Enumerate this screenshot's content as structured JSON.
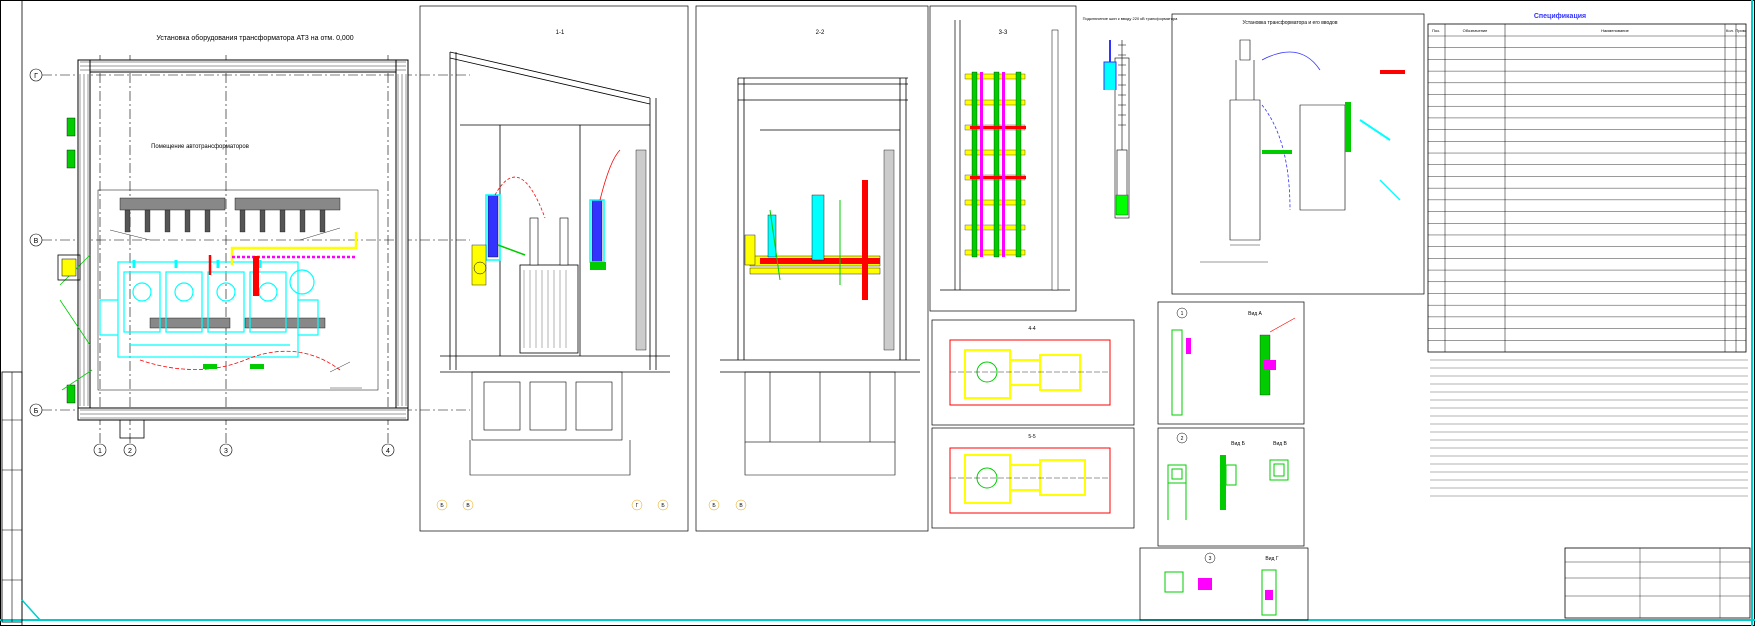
{
  "sheet": {
    "plan_title": "Установка оборудования трансформатора АТ3 на отм. 0,000",
    "plan_room_label": "Помещение автотрансформаторов",
    "section_labels": [
      "1-1",
      "2-2",
      "3-3",
      "4-4",
      "5-5"
    ],
    "grid_rows": [
      "Г",
      "В",
      "Б"
    ],
    "grid_cols": [
      "1",
      "2",
      "3",
      "4"
    ],
    "axis_letters_bottom": [
      "Б",
      "В",
      "Г",
      "Б"
    ],
    "terminal_title": "Подключение шин к вводу 220 кВ трансформатора",
    "bushing_title": "Установка трансформатора и его вводов",
    "view_labels": [
      "Вид А",
      "Вид Б",
      "Вид В",
      "Вид Г"
    ],
    "node_numbers": [
      "1",
      "2",
      "3"
    ]
  },
  "spec": {
    "title": "Спецификация",
    "header": [
      "Поз.",
      "Обозначение",
      "Наименование",
      "Кол.",
      "Прим."
    ],
    "row_count": 27
  },
  "colors": {
    "line": "#000000",
    "cyan": "#00ffff",
    "yellow": "#ffff00",
    "red": "#ff0000",
    "green": "#00cc00",
    "magenta": "#ff00ff",
    "blue": "#3333ff",
    "frame": "#00cccc"
  }
}
